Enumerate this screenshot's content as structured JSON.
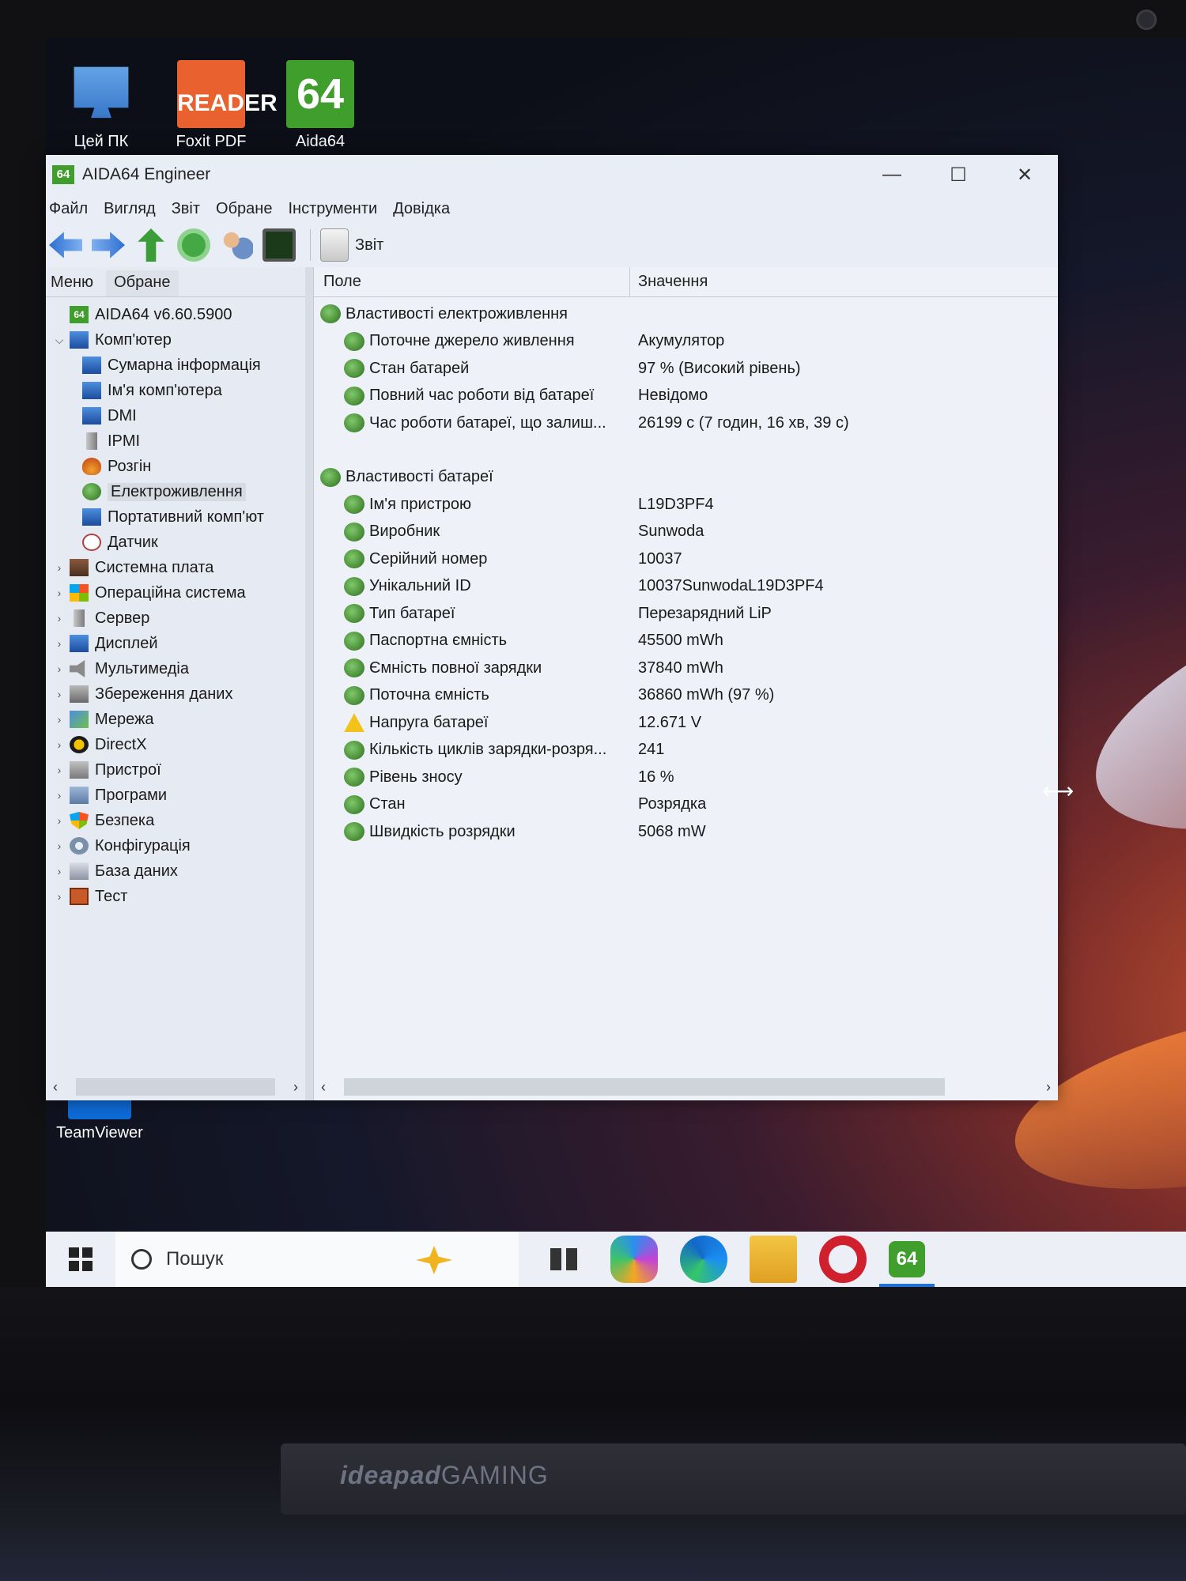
{
  "desktop": {
    "icons": [
      {
        "label": "Цей ПК",
        "icon": "computer-icon"
      },
      {
        "label": "Foxit PDF",
        "icon": "foxit-reader-icon",
        "logo_text": "READER"
      },
      {
        "label": "Aida64",
        "icon": "aida64-icon",
        "logo_text": "64"
      },
      {
        "label": "TeamViewer",
        "icon": "teamviewer-icon"
      }
    ],
    "brand_ideapad": "ideapad",
    "brand_gaming": "GAMING"
  },
  "window": {
    "logo_text": "64",
    "title": "AIDA64 Engineer",
    "controls": {
      "minimize": "—",
      "maximize": "☐",
      "close": "✕"
    },
    "menu": [
      "Файл",
      "Вигляд",
      "Звіт",
      "Обране",
      "Інструменти",
      "Довідка"
    ],
    "toolbar": {
      "report_label": "Звіт"
    },
    "left_tabs": [
      "Меню",
      "Обране"
    ],
    "tree": [
      {
        "label": "AIDA64 v6.60.5900",
        "level": 0,
        "icon": "aida64-icon",
        "arrow": ""
      },
      {
        "label": "Комп'ютер",
        "level": 0,
        "icon": "computer-icon",
        "arrow": "⌵"
      },
      {
        "label": "Сумарна інформація",
        "level": 1,
        "icon": "computer-icon",
        "arrow": ""
      },
      {
        "label": "Ім'я комп'ютера",
        "level": 1,
        "icon": "computer-icon",
        "arrow": ""
      },
      {
        "label": "DMI",
        "level": 1,
        "icon": "computer-icon",
        "arrow": ""
      },
      {
        "label": "IPMI",
        "level": 1,
        "icon": "server-icon",
        "arrow": ""
      },
      {
        "label": "Розгін",
        "level": 1,
        "icon": "flame-icon",
        "arrow": ""
      },
      {
        "label": "Електроживлення",
        "level": 1,
        "icon": "battery-icon",
        "arrow": "",
        "selected": true
      },
      {
        "label": "Портативний комп'ют",
        "level": 1,
        "icon": "laptop-icon",
        "arrow": ""
      },
      {
        "label": "Датчик",
        "level": 1,
        "icon": "gauge-icon",
        "arrow": ""
      },
      {
        "label": "Системна плата",
        "level": 0,
        "icon": "motherboard-icon",
        "arrow": "›"
      },
      {
        "label": "Операційна система",
        "level": 0,
        "icon": "windows-icon",
        "arrow": "›"
      },
      {
        "label": "Сервер",
        "level": 0,
        "icon": "server-icon",
        "arrow": "›"
      },
      {
        "label": "Дисплей",
        "level": 0,
        "icon": "monitor-icon",
        "arrow": "›"
      },
      {
        "label": "Мультимедіа",
        "level": 0,
        "icon": "speaker-icon",
        "arrow": "›"
      },
      {
        "label": "Збереження даних",
        "level": 0,
        "icon": "drive-icon",
        "arrow": "›"
      },
      {
        "label": "Мережа",
        "level": 0,
        "icon": "network-icon",
        "arrow": "›"
      },
      {
        "label": "DirectX",
        "level": 0,
        "icon": "directx-icon",
        "arrow": "›"
      },
      {
        "label": "Пристрої",
        "level": 0,
        "icon": "devices-icon",
        "arrow": "›"
      },
      {
        "label": "Програми",
        "level": 0,
        "icon": "programs-icon",
        "arrow": "›"
      },
      {
        "label": "Безпека",
        "level": 0,
        "icon": "shield-icon",
        "arrow": "›"
      },
      {
        "label": "Конфігурація",
        "level": 0,
        "icon": "config-icon",
        "arrow": "›"
      },
      {
        "label": "База даних",
        "level": 0,
        "icon": "database-icon",
        "arrow": "›"
      },
      {
        "label": "Тест",
        "level": 0,
        "icon": "test-icon",
        "arrow": "›"
      }
    ],
    "columns": {
      "field": "Поле",
      "value": "Значення"
    },
    "rows": [
      {
        "type": "section",
        "field": "Властивості електроживлення",
        "value": "",
        "icon": "battery-icon"
      },
      {
        "type": "item",
        "field": "Поточне джерело живлення",
        "value": "Акумулятор",
        "icon": "battery-icon"
      },
      {
        "type": "item",
        "field": "Стан батарей",
        "value": "97 % (Високий рівень)",
        "icon": "battery-icon"
      },
      {
        "type": "item",
        "field": "Повний час роботи від батареї",
        "value": "Невідомо",
        "icon": "battery-icon"
      },
      {
        "type": "item",
        "field": "Час роботи батареї, що залиш...",
        "value": "26199 с (7 годин, 16 хв, 39 с)",
        "icon": "battery-icon"
      },
      {
        "type": "gap",
        "field": "",
        "value": "",
        "icon": ""
      },
      {
        "type": "section",
        "field": "Властивості батареї",
        "value": "",
        "icon": "battery-icon"
      },
      {
        "type": "item",
        "field": "Ім'я пристрою",
        "value": "L19D3PF4",
        "icon": "battery-icon"
      },
      {
        "type": "item",
        "field": "Виробник",
        "value": "Sunwoda",
        "icon": "battery-icon"
      },
      {
        "type": "item",
        "field": "Серійний номер",
        "value": "10037",
        "icon": "battery-icon"
      },
      {
        "type": "item",
        "field": "Унікальний ID",
        "value": "10037SunwodaL19D3PF4",
        "icon": "battery-icon"
      },
      {
        "type": "item",
        "field": "Тип батареї",
        "value": "Перезарядний LiP",
        "icon": "battery-icon"
      },
      {
        "type": "item",
        "field": "Паспортна ємність",
        "value": "45500 mWh",
        "icon": "battery-icon"
      },
      {
        "type": "item",
        "field": "Ємність повної зарядки",
        "value": "37840 mWh",
        "icon": "battery-icon"
      },
      {
        "type": "item",
        "field": "Поточна ємність",
        "value": "36860 mWh  (97 %)",
        "icon": "battery-icon"
      },
      {
        "type": "item",
        "field": "Напруга батареї",
        "value": "12.671 V",
        "icon": "warning-icon"
      },
      {
        "type": "item",
        "field": "Кількість циклів зарядки-розря...",
        "value": "241",
        "icon": "battery-icon"
      },
      {
        "type": "item",
        "field": "Рівень зносу",
        "value": "16 %",
        "icon": "battery-icon"
      },
      {
        "type": "item",
        "field": "Стан",
        "value": "Розрядка",
        "icon": "battery-icon"
      },
      {
        "type": "item",
        "field": "Швидкість розрядки",
        "value": "5068 mW",
        "icon": "battery-icon"
      }
    ],
    "scroll": {
      "left": "‹",
      "right": "›"
    }
  },
  "taskbar": {
    "search_label": "Пошук",
    "apps": [
      {
        "icon": "task-view-icon"
      },
      {
        "icon": "copilot-icon"
      },
      {
        "icon": "edge-icon"
      },
      {
        "icon": "file-explorer-icon"
      },
      {
        "icon": "opera-icon"
      },
      {
        "icon": "aida64-icon",
        "label": "64",
        "active": true
      }
    ]
  }
}
